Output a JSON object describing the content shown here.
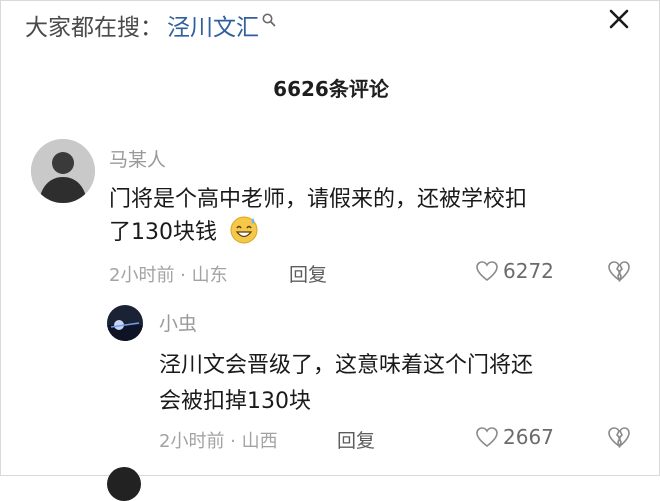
{
  "search": {
    "prefix": "大家都在搜：",
    "term": "泾川文汇"
  },
  "header": {
    "comment_count": "6626条评论"
  },
  "comments": [
    {
      "username": "马某人",
      "lines": [
        "门将是个高中老师，请假来的，还被学校扣",
        "了130块钱"
      ],
      "emoji": "grinning-sweat-emoji",
      "time_location": "2小时前 · 山东",
      "reply_label": "回复",
      "likes": "6272"
    },
    {
      "username": "小虫",
      "lines": [
        "泾川文会晋级了，这意味着这个门将还",
        "会被扣掉130块"
      ],
      "time_location": "2小时前 · 山西",
      "reply_label": "回复",
      "likes": "2667"
    }
  ]
}
